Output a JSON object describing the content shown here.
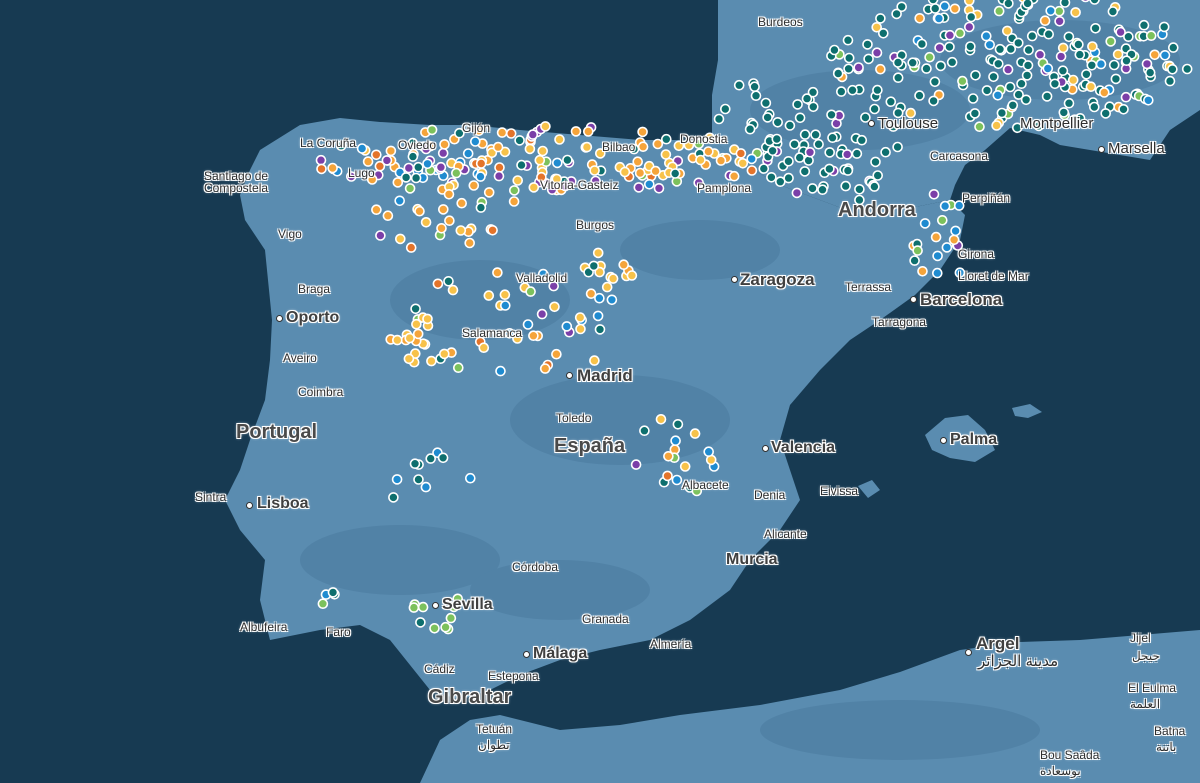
{
  "colors": {
    "sea": "#173a52",
    "land": "#5a8cb0",
    "land_dark": "#4a7a9e",
    "marker_teal": "#0e6f6e",
    "marker_orange": "#f5a43a",
    "marker_yellow": "#f7c24a",
    "marker_purple": "#7b3fa8",
    "marker_blue": "#1f8bd0",
    "marker_green": "#7cc15c",
    "marker_darkorange": "#e4742a"
  },
  "labels": {
    "countries": {
      "portugal": "Portugal",
      "espana": "España",
      "andorra": "Andorra"
    },
    "cities": {
      "burdeos": "Burdeos",
      "toulouse": "Toulouse",
      "montpellier": "Montpellier",
      "marsella": "Marsella",
      "carcasona": "Carcasona",
      "perpinan": "Perpiñán",
      "la_coruna": "La Coruña",
      "gijon": "Gijón",
      "lugo": "Lugo",
      "santiago": "Santiago de\nCompostela",
      "oviedo": "Oviedo",
      "bilbao": "Bilbao",
      "donostia": "Donostia",
      "pamplona": "Pamplona",
      "vitoria": "Vitoria-Gasteiz",
      "vigo": "Vigo",
      "burgos": "Burgos",
      "braga": "Braga",
      "valladolid": "Valladolid",
      "zaragoza": "Zaragoza",
      "girona": "Girona",
      "lloret": "Lloret de Mar",
      "terrassa": "Terrassa",
      "barcelona": "Barcelona",
      "tarragona": "Tarragona",
      "oporto": "Oporto",
      "salamanca": "Salamanca",
      "aveiro": "Aveiro",
      "madrid": "Madrid",
      "coimbra": "Coimbra",
      "toledo": "Toledo",
      "palma": "Palma",
      "valencia": "Valencia",
      "albacete": "Albacete",
      "sintra": "Sintra",
      "lisboa": "Lisboa",
      "denia": "Denia",
      "eivissa": "Eivissa",
      "alicante": "Alicante",
      "cordoba": "Córdoba",
      "murcia": "Murcia",
      "sevilla": "Sevilla",
      "granada": "Granada",
      "albufeira": "Albufeira",
      "faro": "Faro",
      "almeria": "Almería",
      "argel": "Argel",
      "argel_ar": "مدينة الجزائر",
      "jijel": "Jijel",
      "jijel_ar": "جيجل",
      "cadiz": "Cádiz",
      "malaga": "Málaga",
      "estepona": "Estepona",
      "gibraltar": "Gibraltar",
      "el_eulma": "El Eulma",
      "el_eulma_ar": "العلمة",
      "tetuan": "Tetuán",
      "tetuan_ar": "تطوان",
      "batna": "Batna",
      "batna_ar": "باتنة",
      "bou_saada": "Bou Saâda",
      "bou_saada_ar": "بوسعادة"
    }
  }
}
